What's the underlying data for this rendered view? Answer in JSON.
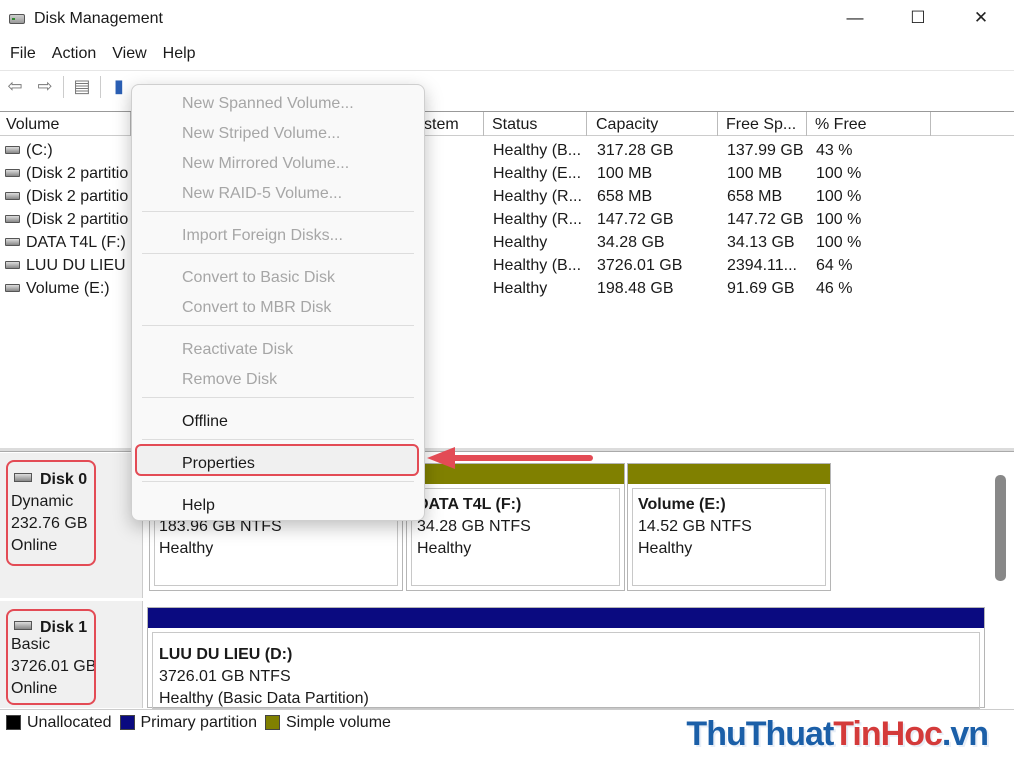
{
  "window": {
    "title": "Disk Management",
    "controls": {
      "minimize": "—",
      "maximize": "☐",
      "close": "✕"
    }
  },
  "menu": [
    "File",
    "Action",
    "View",
    "Help"
  ],
  "list": {
    "columns": [
      "Volume",
      "stem",
      "Status",
      "Capacity",
      "Free Sp...",
      "% Free"
    ],
    "rows": [
      {
        "volume": " (C:)",
        "status": "Healthy (B...",
        "capacity": "317.28 GB",
        "free": "137.99 GB",
        "pct": "43 %"
      },
      {
        "volume": "(Disk 2 partitio",
        "status": "Healthy (E...",
        "capacity": "100 MB",
        "free": "100 MB",
        "pct": "100 %"
      },
      {
        "volume": "(Disk 2 partitio",
        "status": "Healthy (R...",
        "capacity": "658 MB",
        "free": "658 MB",
        "pct": "100 %"
      },
      {
        "volume": "(Disk 2 partitio",
        "status": "Healthy (R...",
        "capacity": "147.72 GB",
        "free": "147.72 GB",
        "pct": "100 %"
      },
      {
        "volume": "DATA T4L (F:)",
        "status": "Healthy",
        "capacity": "34.28 GB",
        "free": "34.13 GB",
        "pct": "100 %"
      },
      {
        "volume": "LUU DU LIEU (I",
        "status": "Healthy (B...",
        "capacity": "3726.01 GB",
        "free": "2394.11...",
        "pct": "64 %"
      },
      {
        "volume": "Volume (E:)",
        "status": "Healthy",
        "capacity": "198.48 GB",
        "free": "91.69 GB",
        "pct": "46 %"
      }
    ]
  },
  "disks": [
    {
      "name": "Disk 0",
      "type": "Dynamic",
      "size": "232.76 GB",
      "state": "Online",
      "partitions": [
        {
          "name": "",
          "size": "183.96 GB NTFS",
          "status": "Healthy"
        },
        {
          "name": "DATA T4L  (F:)",
          "size": "34.28 GB NTFS",
          "status": "Healthy"
        },
        {
          "name": "Volume  (E:)",
          "size": "14.52 GB NTFS",
          "status": "Healthy"
        }
      ]
    },
    {
      "name": "Disk 1",
      "type": "Basic",
      "size": "3726.01 GB",
      "state": "Online",
      "partitions": [
        {
          "name": "LUU DU LIEU  (D:)",
          "size": "3726.01 GB NTFS",
          "status": "Healthy (Basic Data Partition)"
        }
      ]
    }
  ],
  "legend": [
    {
      "label": "Unallocated",
      "color": "#000000"
    },
    {
      "label": "Primary partition",
      "color": "#0a0a80"
    },
    {
      "label": "Simple volume",
      "color": "#808000"
    }
  ],
  "colors": {
    "simple_volume": "#808000",
    "primary_partition": "#0a0a80",
    "highlight": "#e34b55"
  },
  "context_menu": {
    "items": [
      "New Spanned Volume...",
      "New Striped Volume...",
      "New Mirrored Volume...",
      "New RAID-5 Volume...",
      "Import Foreign Disks...",
      "Convert to Basic Disk",
      "Convert to MBR Disk",
      "Reactivate Disk",
      "Remove Disk",
      "Offline",
      "Properties",
      "Help"
    ]
  },
  "watermark": {
    "part1": "ThuThuat",
    "part2": "TinHoc",
    "part3": ".vn"
  }
}
